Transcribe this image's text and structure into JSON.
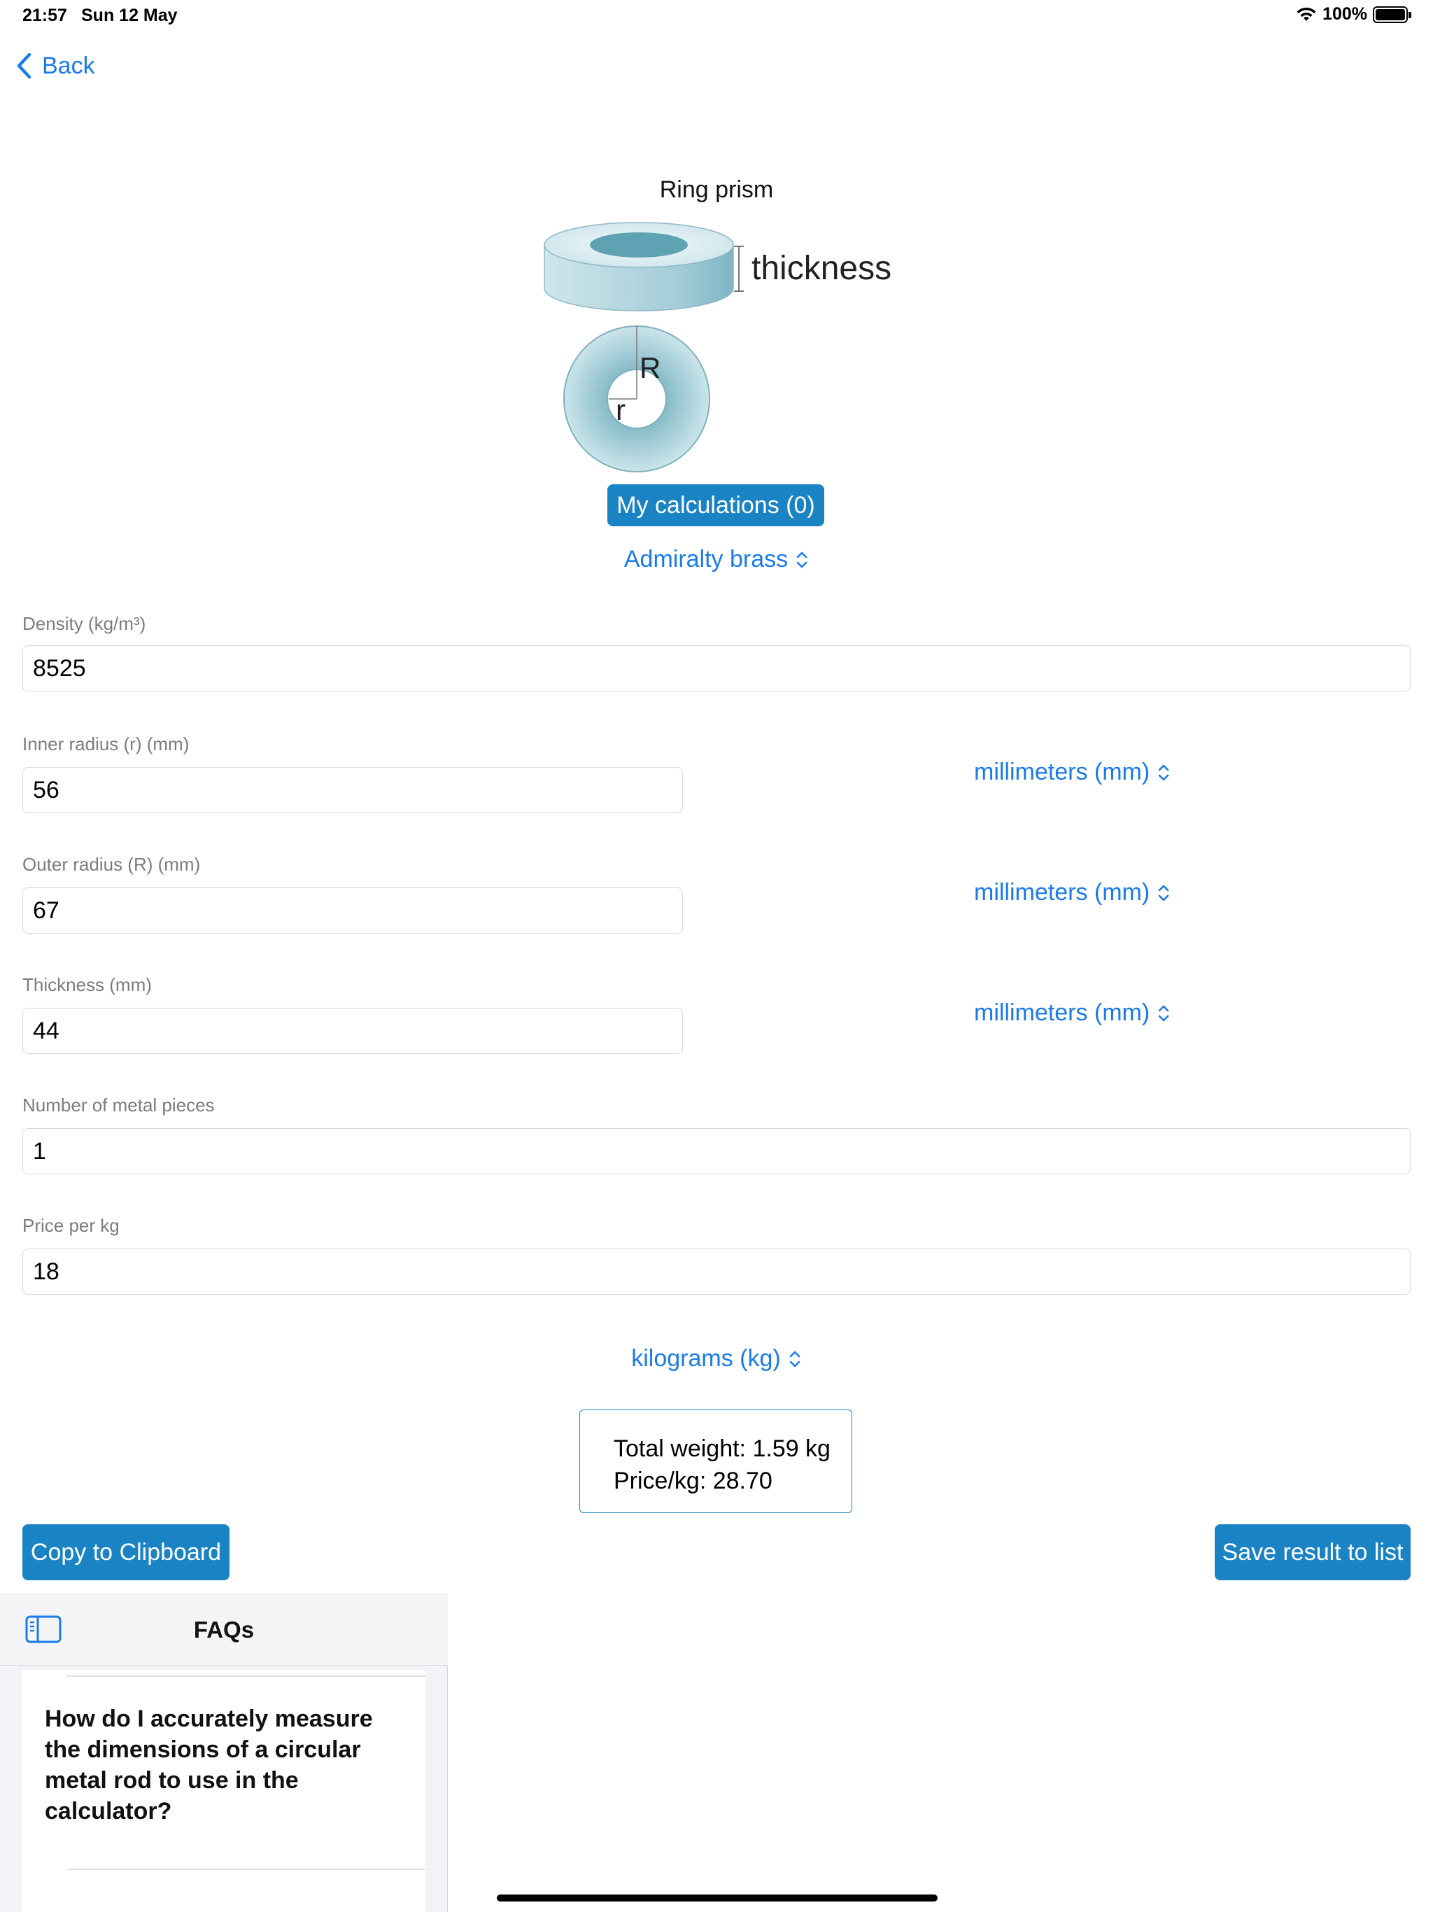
{
  "status_bar": {
    "time": "21:57",
    "date": "Sun 12 May",
    "battery": "100%"
  },
  "nav": {
    "back_label": "Back"
  },
  "shape": {
    "title": "Ring prism",
    "thickness_label": "thickness",
    "outer_radius_label": "R",
    "inner_radius_label": "r"
  },
  "my_calculations_label": "My calculations (0)",
  "material": "Admiralty brass",
  "fields": {
    "density": {
      "label": "Density (kg/m³)",
      "value": "8525"
    },
    "inner_radius": {
      "label": "Inner radius  (r) (mm)",
      "value": "56",
      "unit": "millimeters (mm)"
    },
    "outer_radius": {
      "label": "Outer radius (R) (mm)",
      "value": "67",
      "unit": "millimeters (mm)"
    },
    "thickness": {
      "label": "Thickness (mm)",
      "value": "44",
      "unit": "millimeters (mm)"
    },
    "pieces": {
      "label": "Number of metal pieces",
      "value": "1"
    },
    "price": {
      "label": "Price per kg",
      "value": "18"
    }
  },
  "weight_unit": "kilograms (kg)",
  "result": {
    "total_weight": "Total weight: 1.59 kg",
    "price": "Price/kg: 28.70"
  },
  "actions": {
    "copy_label": "Copy to Clipboard",
    "save_label": "Save result to list"
  },
  "faq": {
    "title": "FAQs",
    "question": "How do I accurately measure the dimensions of a circular metal rod to use in the calculator?"
  },
  "colors": {
    "accent": "#1a7be8",
    "button": "#1983c4"
  }
}
